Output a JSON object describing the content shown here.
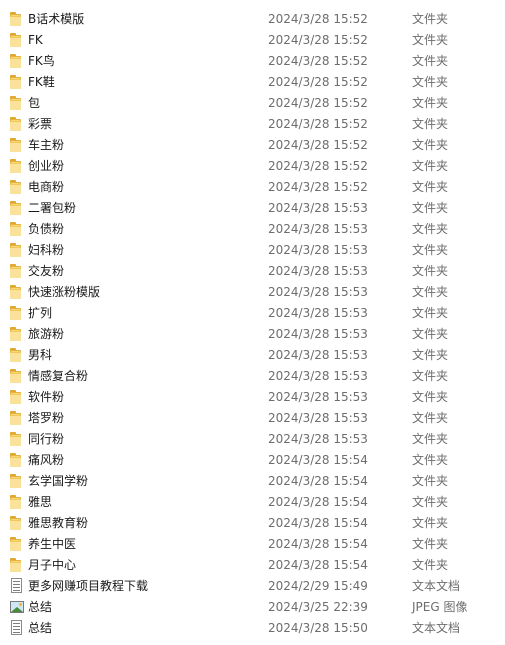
{
  "files": [
    {
      "name": "B话术模版",
      "date": "2024/3/28 15:52",
      "type": "文件夹",
      "icon": "folder-icon"
    },
    {
      "name": "FK",
      "date": "2024/3/28 15:52",
      "type": "文件夹",
      "icon": "folder-icon"
    },
    {
      "name": "FK鸟",
      "date": "2024/3/28 15:52",
      "type": "文件夹",
      "icon": "folder-icon"
    },
    {
      "name": "FK鞋",
      "date": "2024/3/28 15:52",
      "type": "文件夹",
      "icon": "folder-icon"
    },
    {
      "name": "包",
      "date": "2024/3/28 15:52",
      "type": "文件夹",
      "icon": "folder-icon"
    },
    {
      "name": "彩票",
      "date": "2024/3/28 15:52",
      "type": "文件夹",
      "icon": "folder-icon"
    },
    {
      "name": "车主粉",
      "date": "2024/3/28 15:52",
      "type": "文件夹",
      "icon": "folder-icon"
    },
    {
      "name": "创业粉",
      "date": "2024/3/28 15:52",
      "type": "文件夹",
      "icon": "folder-icon"
    },
    {
      "name": "电商粉",
      "date": "2024/3/28 15:52",
      "type": "文件夹",
      "icon": "folder-icon"
    },
    {
      "name": "二署包粉",
      "date": "2024/3/28 15:53",
      "type": "文件夹",
      "icon": "folder-icon"
    },
    {
      "name": "负债粉",
      "date": "2024/3/28 15:53",
      "type": "文件夹",
      "icon": "folder-icon"
    },
    {
      "name": "妇科粉",
      "date": "2024/3/28 15:53",
      "type": "文件夹",
      "icon": "folder-icon"
    },
    {
      "name": "交友粉",
      "date": "2024/3/28 15:53",
      "type": "文件夹",
      "icon": "folder-icon"
    },
    {
      "name": "快速涨粉模版",
      "date": "2024/3/28 15:53",
      "type": "文件夹",
      "icon": "folder-icon"
    },
    {
      "name": "扩列",
      "date": "2024/3/28 15:53",
      "type": "文件夹",
      "icon": "folder-icon"
    },
    {
      "name": "旅游粉",
      "date": "2024/3/28 15:53",
      "type": "文件夹",
      "icon": "folder-icon"
    },
    {
      "name": "男科",
      "date": "2024/3/28 15:53",
      "type": "文件夹",
      "icon": "folder-icon"
    },
    {
      "name": "情感复合粉",
      "date": "2024/3/28 15:53",
      "type": "文件夹",
      "icon": "folder-icon"
    },
    {
      "name": "软件粉",
      "date": "2024/3/28 15:53",
      "type": "文件夹",
      "icon": "folder-icon"
    },
    {
      "name": "塔罗粉",
      "date": "2024/3/28 15:53",
      "type": "文件夹",
      "icon": "folder-icon"
    },
    {
      "name": "同行粉",
      "date": "2024/3/28 15:53",
      "type": "文件夹",
      "icon": "folder-icon"
    },
    {
      "name": "痛风粉",
      "date": "2024/3/28 15:54",
      "type": "文件夹",
      "icon": "folder-icon"
    },
    {
      "name": "玄学国学粉",
      "date": "2024/3/28 15:54",
      "type": "文件夹",
      "icon": "folder-icon"
    },
    {
      "name": "雅思",
      "date": "2024/3/28 15:54",
      "type": "文件夹",
      "icon": "folder-icon"
    },
    {
      "name": "雅思教育粉",
      "date": "2024/3/28 15:54",
      "type": "文件夹",
      "icon": "folder-icon"
    },
    {
      "name": "养生中医",
      "date": "2024/3/28 15:54",
      "type": "文件夹",
      "icon": "folder-icon"
    },
    {
      "name": "月子中心",
      "date": "2024/3/28 15:54",
      "type": "文件夹",
      "icon": "folder-icon"
    },
    {
      "name": "更多网赚项目教程下载",
      "date": "2024/2/29 15:49",
      "type": "文本文档",
      "icon": "text-document-icon"
    },
    {
      "name": "总结",
      "date": "2024/3/25 22:39",
      "type": "JPEG 图像",
      "icon": "jpeg-image-icon"
    },
    {
      "name": "总结",
      "date": "2024/3/28 15:50",
      "type": "文本文档",
      "icon": "text-document-icon"
    }
  ]
}
